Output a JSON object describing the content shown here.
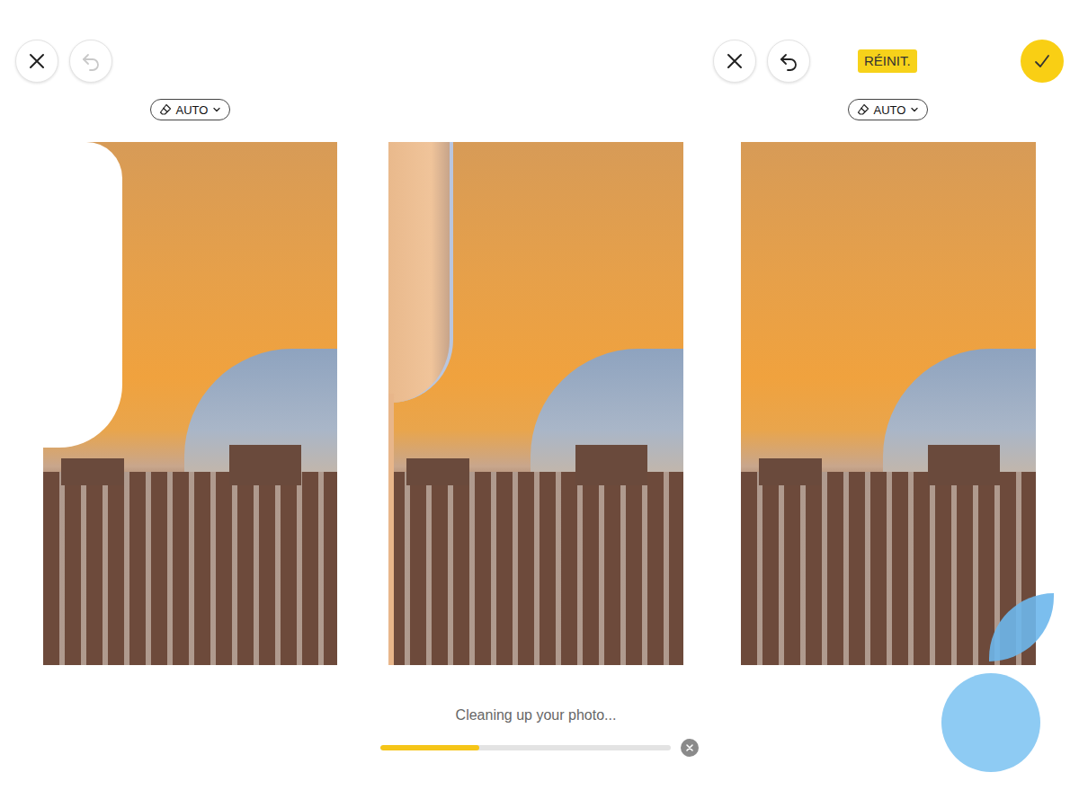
{
  "left": {
    "toolbar": {
      "undo_disabled": true
    },
    "mode": "AUTO",
    "photo": {
      "kind": "masked"
    }
  },
  "middle": {
    "photo": {
      "kind": "processing"
    },
    "status": "Cleaning up your photo...",
    "progress": {
      "level": 0.34
    }
  },
  "right": {
    "toolbar": {
      "undo_disabled": false
    },
    "reset": "RÉINIT.",
    "mode": "AUTO",
    "photo": {
      "kind": "cleaned"
    }
  }
}
